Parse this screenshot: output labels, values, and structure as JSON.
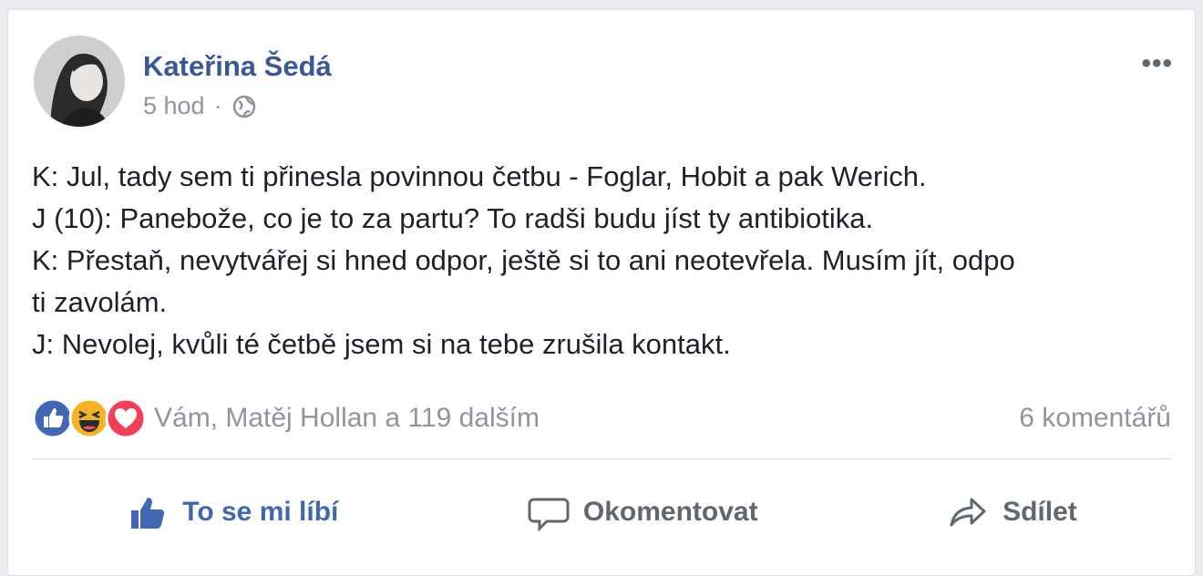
{
  "post": {
    "author": "Kateřina Šedá",
    "time": "5 hod",
    "separator": "·",
    "more": "•••",
    "lines": [
      "K: Jul, tady sem ti přinesla povinnou četbu - Foglar, Hobit a pak Werich.",
      "J (10): Panebože, co je to za partu? To radši budu jíst ty antibiotika.",
      "K: Přestaň, nevytvářej si hned odpor, ještě si to ani neotevřela. Musím jít, odpo",
      "ti zavolám.",
      "J: Nevolej, kvůli té četbě jsem si na tebe zrušila kontakt."
    ]
  },
  "reactions": {
    "icons": [
      "like-reaction-icon",
      "haha-reaction-icon",
      "love-reaction-icon"
    ],
    "likers": "Vám, Matěj Hollan a 119 dalším",
    "comments": "6 komentářů"
  },
  "actions": {
    "like": "To se mi líbí",
    "comment": "Okomentovat",
    "share": "Sdílet"
  },
  "colors": {
    "link": "#385898",
    "like_blue": "#4267b2",
    "muted": "#90949c",
    "text": "#1d2129",
    "love_red": "#f33e58",
    "haha_yellow": "#f7b125"
  }
}
